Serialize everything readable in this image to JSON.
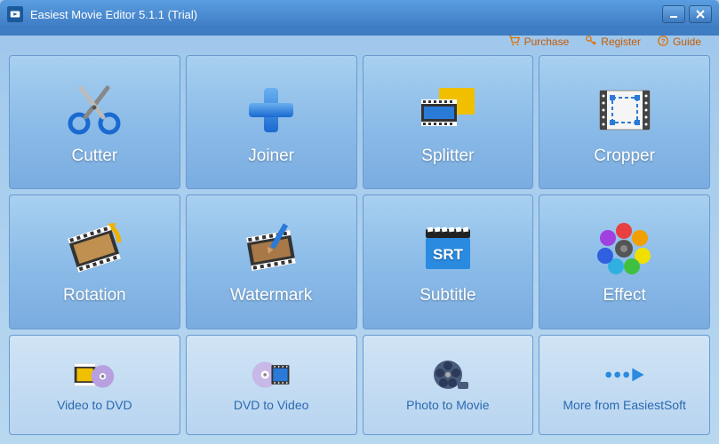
{
  "window": {
    "title": "Easiest Movie Editor 5.1.1 (Trial)"
  },
  "topbar": {
    "purchase": "Purchase",
    "register": "Register",
    "guide": "Guide"
  },
  "tiles": {
    "cutter": "Cutter",
    "joiner": "Joiner",
    "splitter": "Splitter",
    "cropper": "Cropper",
    "rotation": "Rotation",
    "watermark": "Watermark",
    "subtitle": "Subtitle",
    "effect": "Effect",
    "video_to_dvd": "Video to DVD",
    "dvd_to_video": "DVD to Video",
    "photo_to_movie": "Photo to Movie",
    "more": "More from EasiestSoft"
  }
}
